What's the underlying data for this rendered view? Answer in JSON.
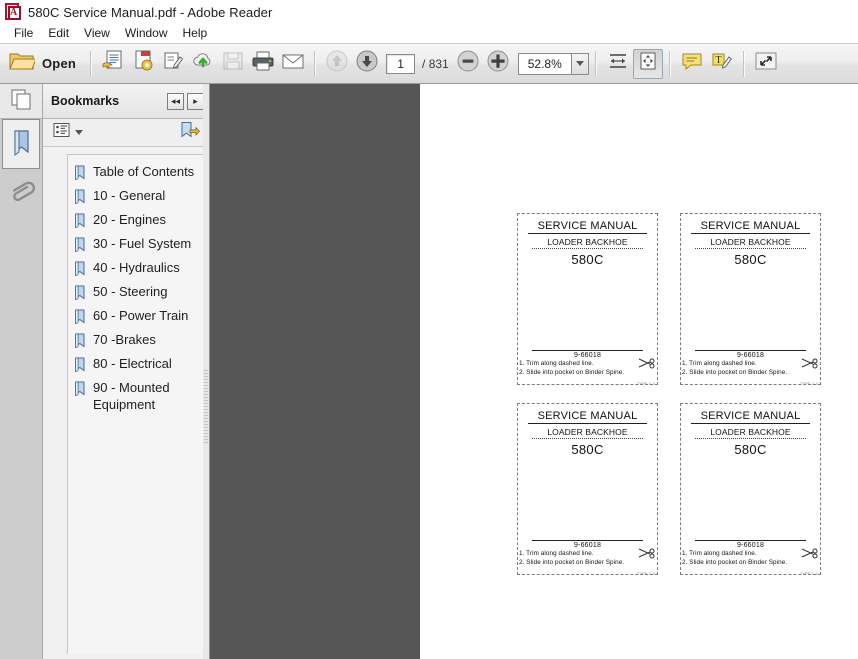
{
  "window": {
    "title": "580C Service Manual.pdf - Adobe Reader",
    "app_icon": "adobe-pdf-icon",
    "accent_red": "#b5122a",
    "workspace_gray": "#565656"
  },
  "menubar": {
    "items": [
      {
        "label": "File"
      },
      {
        "label": "Edit"
      },
      {
        "label": "View"
      },
      {
        "label": "Window"
      },
      {
        "label": "Help"
      }
    ]
  },
  "toolbar": {
    "open_label": "Open",
    "buttons": [
      {
        "name": "open-folder-icon",
        "tooltip": "Open"
      },
      {
        "name": "create-pdf-icon",
        "tooltip": "Create PDF"
      },
      {
        "name": "export-pdf-icon",
        "tooltip": "Export PDF"
      },
      {
        "name": "edit-pdf-icon",
        "tooltip": "Edit PDF"
      },
      {
        "name": "cloud-upload-icon",
        "tooltip": "Send files"
      },
      {
        "name": "save-icon",
        "tooltip": "Save",
        "disabled": true
      },
      {
        "name": "print-icon",
        "tooltip": "Print"
      },
      {
        "name": "email-icon",
        "tooltip": "Email"
      },
      {
        "name": "previous-page-icon",
        "tooltip": "Previous Page",
        "disabled": true
      },
      {
        "name": "next-page-icon",
        "tooltip": "Next Page"
      },
      {
        "name": "zoom-out-icon",
        "tooltip": "Zoom Out"
      },
      {
        "name": "zoom-in-icon",
        "tooltip": "Zoom In"
      },
      {
        "name": "fit-width-icon",
        "tooltip": "Fit Width"
      },
      {
        "name": "fit-page-icon",
        "tooltip": "Fit Page",
        "pressed": true
      },
      {
        "name": "comment-icon",
        "tooltip": "Comment"
      },
      {
        "name": "highlight-text-icon",
        "tooltip": "Highlight Text"
      },
      {
        "name": "expand-pane-icon",
        "tooltip": "Show Tools Pane"
      }
    ],
    "page_number": "1",
    "page_total": "/ 831",
    "zoom_value": "52.8%",
    "zoom_dropdown_icon": "chevron-down-icon"
  },
  "rail": {
    "items": [
      {
        "name": "page-thumbnails-icon",
        "label": "Page Thumbnails",
        "selected": false
      },
      {
        "name": "bookmarks-ribbon-icon",
        "label": "Bookmarks",
        "selected": true
      },
      {
        "name": "attachments-paperclip-icon",
        "label": "Attachments",
        "selected": false
      }
    ]
  },
  "panel": {
    "title": "Bookmarks",
    "nav_prev_icon": "double-chevron-left-icon",
    "nav_next_icon": "chevron-right-icon",
    "options_icon": "options-list-icon",
    "options_caret_icon": "chevron-down-icon",
    "new_bookmark_icon": "new-bookmark-icon",
    "bookmarks": [
      {
        "label": "Table of Contents"
      },
      {
        "label": "10 - General"
      },
      {
        "label": "20 - Engines"
      },
      {
        "label": "30 - Fuel System"
      },
      {
        "label": "40 - Hydraulics"
      },
      {
        "label": "50 - Steering"
      },
      {
        "label": "60 - Power Train"
      },
      {
        "label": "70 -Brakes"
      },
      {
        "label": "80 - Electrical"
      },
      {
        "label": "90 - Mounted Equipment"
      }
    ]
  },
  "document": {
    "cards": [
      {
        "title": "SERVICE MANUAL",
        "subtitle": "LOADER BACKHOE",
        "model": "580C",
        "part_number": "9-66018",
        "note_1": "1. Trim along dashed line.",
        "note_2": "2. Slide into pocket on Binder Spine.",
        "footer_mark": "TYPE 1-4",
        "scissors_icon": "scissors-icon"
      },
      {
        "title": "SERVICE MANUAL",
        "subtitle": "LOADER BACKHOE",
        "model": "580C",
        "part_number": "9-66018",
        "note_1": "1. Trim along dashed line.",
        "note_2": "2. Slide into pocket on Binder Spine.",
        "footer_mark": "TYPE 1-4",
        "scissors_icon": "scissors-icon"
      },
      {
        "title": "SERVICE MANUAL",
        "subtitle": "LOADER BACKHOE",
        "model": "580C",
        "part_number": "9-66018",
        "note_1": "1. Trim along dashed line.",
        "note_2": "2. Slide into pocket on Binder Spine.",
        "footer_mark": "TYPE 1-4",
        "scissors_icon": "scissors-icon"
      },
      {
        "title": "SERVICE MANUAL",
        "subtitle": "LOADER BACKHOE",
        "model": "580C",
        "part_number": "9-66018",
        "note_1": "1. Trim along dashed line.",
        "note_2": "2. Slide into pocket on Binder Spine.",
        "footer_mark": "TYPE 1-4",
        "scissors_icon": "scissors-icon"
      }
    ]
  }
}
